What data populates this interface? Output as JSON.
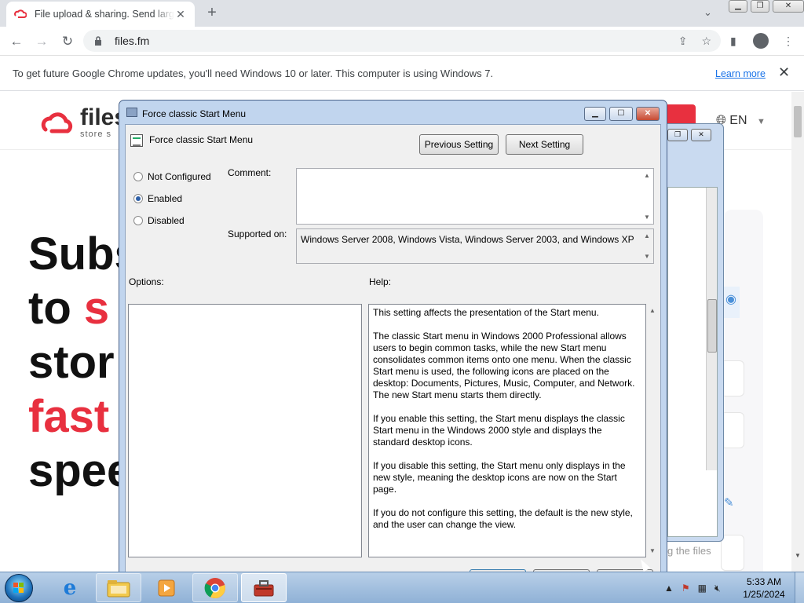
{
  "browser": {
    "tab_title": "File upload & sharing. Send large files",
    "tab_close": "✕",
    "new_tab": "+",
    "url": "files.fm",
    "infobar_message": "To get future Google Chrome updates, you'll need Windows 10 or later. This computer is using Windows 7.",
    "infobar_link": "Learn more",
    "infobar_close": "✕"
  },
  "site": {
    "logo_name": "files",
    "logo_tagline": "store  s",
    "lang": "EN",
    "hero_lines": [
      "Subs",
      "to ",
      "stor",
      "fast",
      "spee"
    ],
    "hero_red": "s",
    "partial_text": "g the files"
  },
  "dialog": {
    "title": "Force classic Start Menu",
    "policy_name": "Force classic Start Menu",
    "prev_button": "Previous Setting",
    "next_button": "Next Setting",
    "radios": [
      {
        "label": "Not Configured",
        "checked": false
      },
      {
        "label": "Enabled",
        "checked": true
      },
      {
        "label": "Disabled",
        "checked": false
      }
    ],
    "comment_label": "Comment:",
    "comment_value": "",
    "supported_label": "Supported on:",
    "supported_value": "Windows Server 2008, Windows Vista, Windows Server 2003, and Windows XP",
    "options_label": "Options:",
    "help_label": "Help:",
    "help_paragraphs": [
      "This setting affects the presentation of the Start menu.",
      "The classic Start menu in Windows 2000 Professional allows users to begin common tasks, while the new Start menu consolidates common items onto one menu. When the classic Start menu is used, the following icons are placed on the desktop: Documents, Pictures, Music, Computer, and Network. The new Start menu starts them directly.",
      "If you enable this setting, the Start menu displays the classic Start menu in the Windows 2000 style and displays the standard desktop icons.",
      "If you disable this setting, the Start menu only displays in the new style, meaning the desktop icons are now on the Start page.",
      "If you do not configure this setting, the default is the new style, and the user can change the view."
    ]
  },
  "taskbar": {
    "time": "5:33 AM",
    "date": "1/25/2024"
  },
  "colors": {
    "brand_red": "#e8303f",
    "chrome_blue": "#1a73e8"
  }
}
